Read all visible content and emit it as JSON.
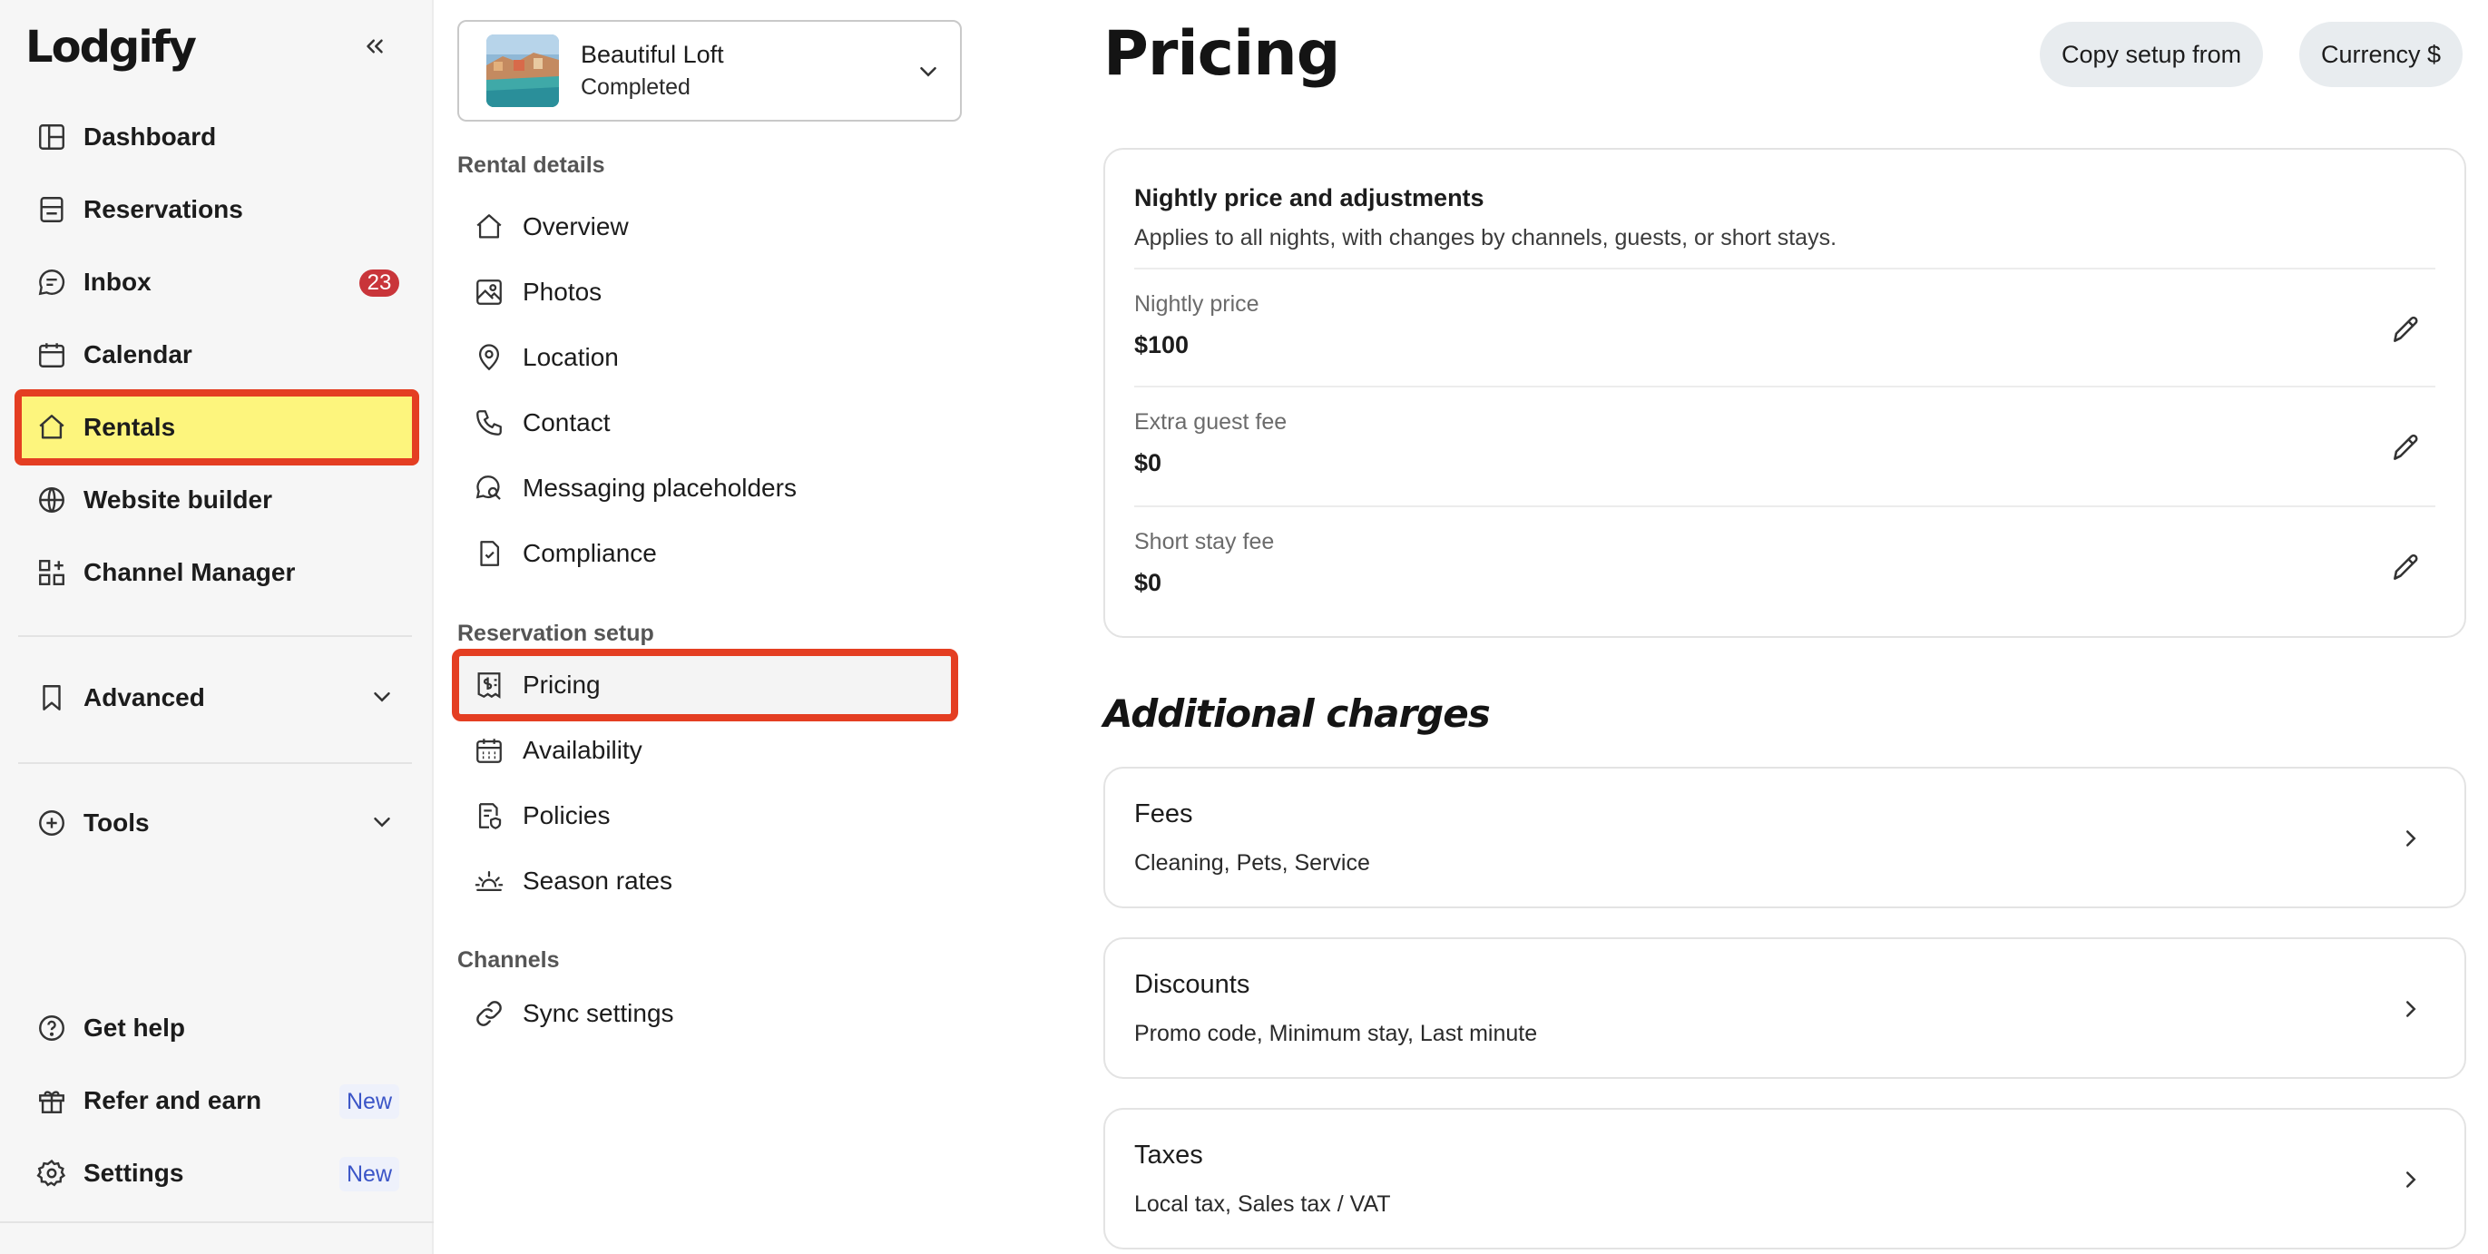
{
  "sidebar": {
    "logo": "Lodgify",
    "items": [
      {
        "label": "Dashboard",
        "icon": "dashboard-icon"
      },
      {
        "label": "Reservations",
        "icon": "reservations-icon"
      },
      {
        "label": "Inbox",
        "icon": "inbox-icon",
        "badge": "23"
      },
      {
        "label": "Calendar",
        "icon": "calendar-icon"
      },
      {
        "label": "Rentals",
        "icon": "house-icon",
        "active": true
      },
      {
        "label": "Website builder",
        "icon": "globe-icon"
      },
      {
        "label": "Channel Manager",
        "icon": "channel-manager-icon"
      }
    ],
    "groups": [
      {
        "label": "Advanced",
        "icon": "bookmark-icon"
      },
      {
        "label": "Tools",
        "icon": "plus-circle-icon"
      }
    ],
    "footer": [
      {
        "label": "Get help",
        "icon": "help-icon"
      },
      {
        "label": "Refer and earn",
        "icon": "gift-icon",
        "badge": "New"
      },
      {
        "label": "Settings",
        "icon": "gear-icon",
        "badge": "New"
      }
    ]
  },
  "rental": {
    "name": "Beautiful Loft",
    "status": "Completed"
  },
  "subnav": {
    "sections": [
      {
        "label": "Rental details",
        "items": [
          "Overview",
          "Photos",
          "Location",
          "Contact",
          "Messaging placeholders",
          "Compliance"
        ]
      },
      {
        "label": "Reservation setup",
        "items": [
          "Pricing",
          "Availability",
          "Policies",
          "Season rates"
        ]
      },
      {
        "label": "Channels",
        "items": [
          "Sync settings"
        ]
      }
    ]
  },
  "main": {
    "title": "Pricing",
    "copy_setup": "Copy setup from",
    "currency": "Currency $",
    "nightly_card": {
      "title": "Nightly price and adjustments",
      "description": "Applies to all nights, with changes by channels, guests, or short stays.",
      "rows": [
        {
          "label": "Nightly price",
          "value": "$100"
        },
        {
          "label": "Extra guest fee",
          "value": "$0"
        },
        {
          "label": "Short stay fee",
          "value": "$0"
        }
      ]
    },
    "additional_title": "Additional charges",
    "charges": [
      {
        "title": "Fees",
        "desc": "Cleaning, Pets, Service"
      },
      {
        "title": "Discounts",
        "desc": "Promo code, Minimum stay, Last minute"
      },
      {
        "title": "Taxes",
        "desc": "Local tax, Sales tax / VAT"
      }
    ]
  },
  "colors": {
    "active_highlight": "#fdf57d",
    "annotation_red": "#e43e22",
    "badge_red": "#c9353a",
    "new_badge_blue": "#3b55c7"
  }
}
